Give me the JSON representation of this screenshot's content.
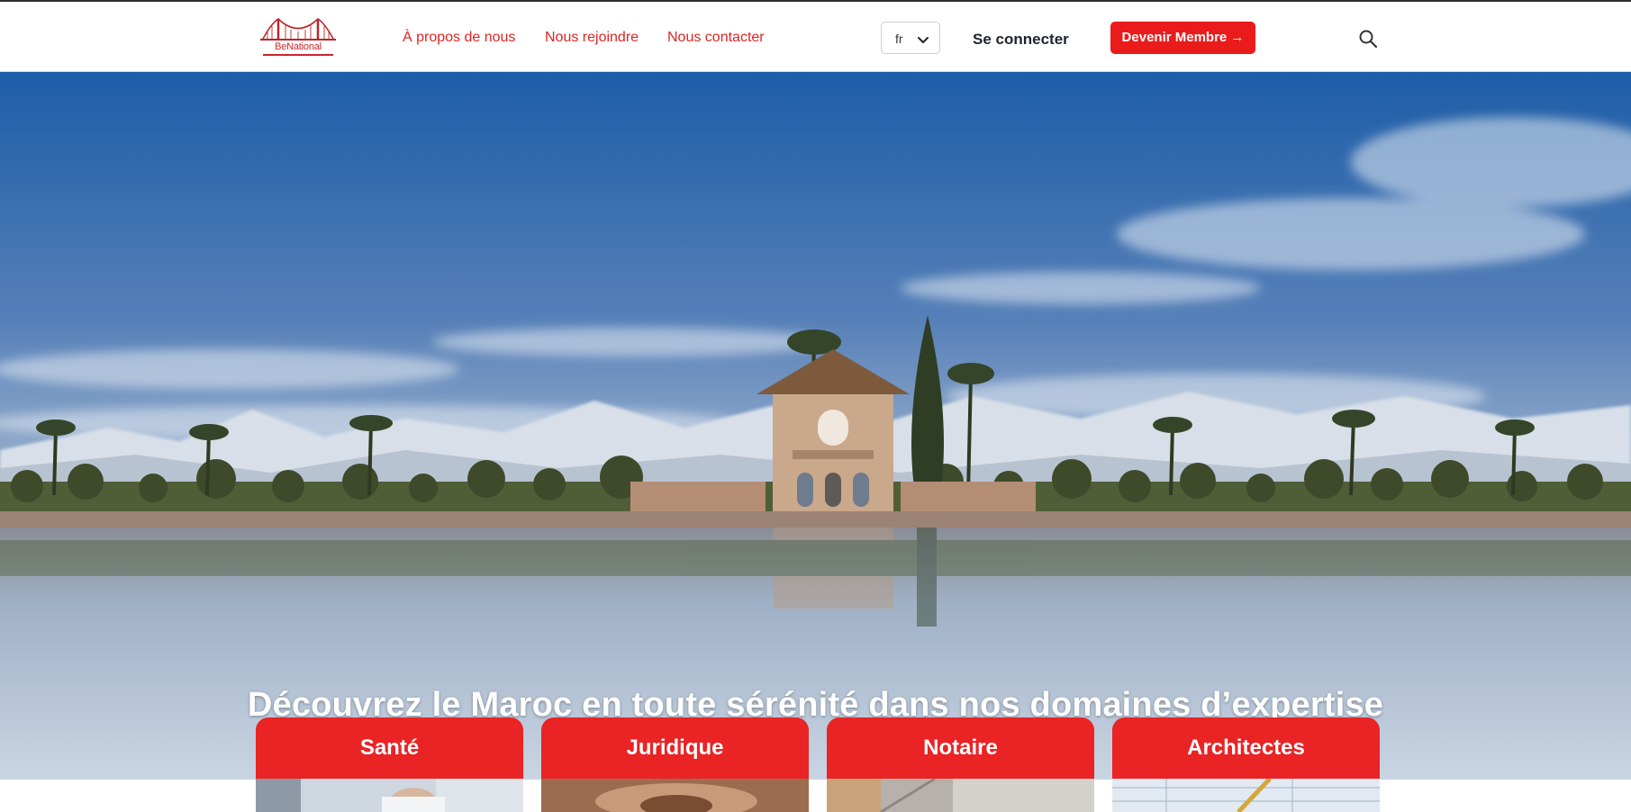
{
  "brand": {
    "logo_prefix": "Be",
    "logo_suffix": "National"
  },
  "nav": {
    "links": [
      "À propos de nous",
      "Nous rejoindre",
      "Nous contacter"
    ],
    "language": "fr",
    "login_label": "Se connecter",
    "member_button_label": "Devenir Membre →",
    "search_icon": "search-icon"
  },
  "hero": {
    "title": "Découvrez le Maroc en toute sérénité dans nos domaines d’expertise"
  },
  "cards": [
    {
      "label": "Santé"
    },
    {
      "label": "Juridique"
    },
    {
      "label": "Notaire"
    },
    {
      "label": "Architectes"
    }
  ],
  "colors": {
    "accent": "#ea1b1b",
    "nav_link": "#e02323",
    "card_header": "#ea2325",
    "sky_top": "#1d5da8",
    "login_text": "#1f2430"
  }
}
